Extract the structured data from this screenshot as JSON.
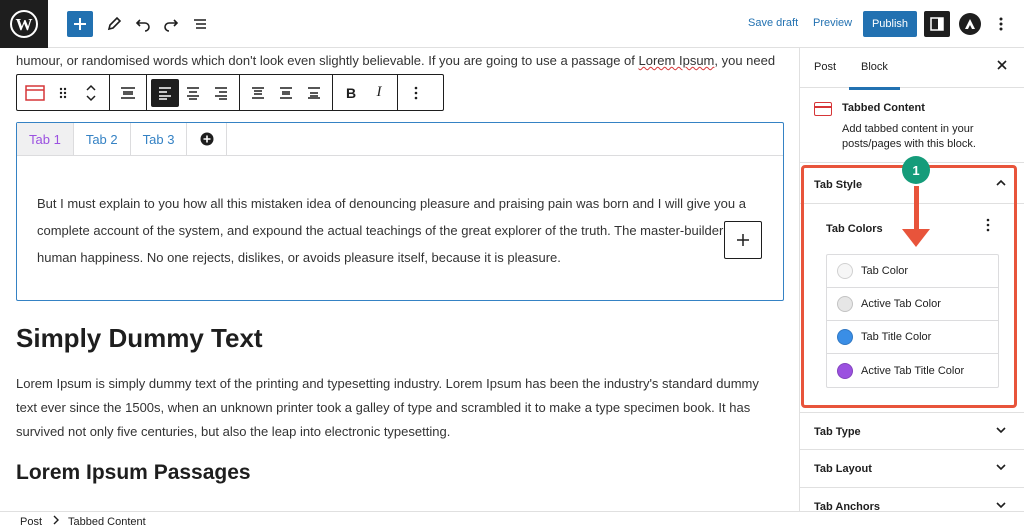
{
  "topbar": {
    "save_draft": "Save draft",
    "preview": "Preview",
    "publish": "Publish",
    "icons": [
      "wordpress-logo",
      "plus-icon",
      "pencil-icon",
      "undo-icon",
      "redo-icon",
      "list-view-icon",
      "sidebar-toggle-icon",
      "astra-icon",
      "more-options-icon"
    ]
  },
  "editor": {
    "intro_part1": "humour, or randomised words which don't look even slightly believable. If you are going to use a passage of ",
    "intro_squiggle": "Lorem Ipsum",
    "intro_part2": ", you need",
    "tabs": [
      {
        "label": "Tab 1",
        "active": true
      },
      {
        "label": "Tab 2",
        "active": false
      },
      {
        "label": "Tab 3",
        "active": false
      }
    ],
    "tab_add_icon": "⊕",
    "tab_content": "But I must explain to you how all this mistaken idea of denouncing pleasure and praising pain was born and I will give you a complete account of the system, and expound the actual teachings of the great explorer of the truth. The master-builder of human happiness. No one rejects, dislikes, or avoids pleasure itself, because it is pleasure.",
    "heading": "Simply Dummy Text",
    "paragraph": "Lorem Ipsum is simply dummy text of the printing and typesetting industry. Lorem Ipsum has been the industry's standard dummy text ever since the 1500s, when an unknown printer took a galley of type and scrambled it to make a type specimen book. It has survived not only five centuries, but also the leap into electronic typesetting.",
    "subheading": "Lorem Ipsum Passages"
  },
  "sidebar": {
    "tab_post": "Post",
    "tab_block": "Block",
    "block_title": "Tabbed Content",
    "block_desc": "Add tabbed content in your posts/pages with this block.",
    "tab_style": "Tab Style",
    "tab_colors": "Tab Colors",
    "colors": [
      {
        "label": "Tab Color",
        "swatch": "#f6f6f6"
      },
      {
        "label": "Active Tab Color",
        "swatch": "#e6e6e6"
      },
      {
        "label": "Tab Title Color",
        "swatch": "#3a8ee6"
      },
      {
        "label": "Active Tab Title Color",
        "swatch": "#9b51e0"
      }
    ],
    "tab_type": "Tab Type",
    "tab_layout": "Tab Layout",
    "tab_anchors": "Tab Anchors"
  },
  "annotation": {
    "step": "1",
    "color": "#e8543b"
  },
  "footer": {
    "crumb1": "Post",
    "crumb2": "Tabbed Content"
  }
}
